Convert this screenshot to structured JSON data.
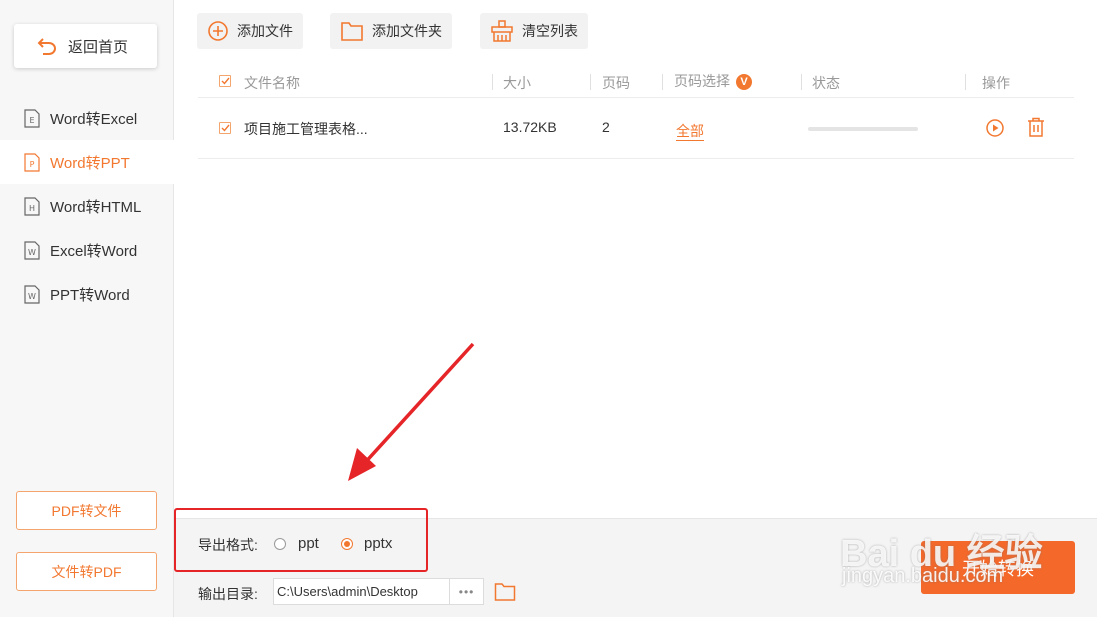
{
  "sidebar": {
    "home_label": "返回首页",
    "items": [
      {
        "label": "Word转Excel",
        "icon": "E"
      },
      {
        "label": "Word转PPT",
        "icon": "P",
        "active": true
      },
      {
        "label": "Word转HTML",
        "icon": "H"
      },
      {
        "label": "Excel转Word",
        "icon": "W"
      },
      {
        "label": "PPT转Word",
        "icon": "W"
      }
    ],
    "pdf_to_file": "PDF转文件",
    "file_to_pdf": "文件转PDF"
  },
  "toolbar": {
    "add_file": "添加文件",
    "add_folder": "添加文件夹",
    "clear_list": "清空列表"
  },
  "table": {
    "headers": {
      "name": "文件名称",
      "size": "大小",
      "pages": "页码",
      "page_select": "页码选择",
      "page_select_badge": "V",
      "status": "状态",
      "actions": "操作"
    },
    "rows": [
      {
        "name": "项目施工管理表格...",
        "size": "13.72KB",
        "pages": "2",
        "page_select": "全部",
        "progress": 0
      }
    ]
  },
  "bottom": {
    "format_label": "导出格式:",
    "options": [
      "ppt",
      "pptx"
    ],
    "selected": "pptx",
    "output_label": "输出目录:",
    "output_path": "C:\\Users\\admin\\Desktop",
    "browse_label": "•••",
    "start_label": "开始转换"
  },
  "watermark": {
    "line1": "Bai du 经验",
    "line2": "jingyan.baidu.com"
  },
  "colors": {
    "accent": "#f27830",
    "annotation": "#e52528"
  }
}
